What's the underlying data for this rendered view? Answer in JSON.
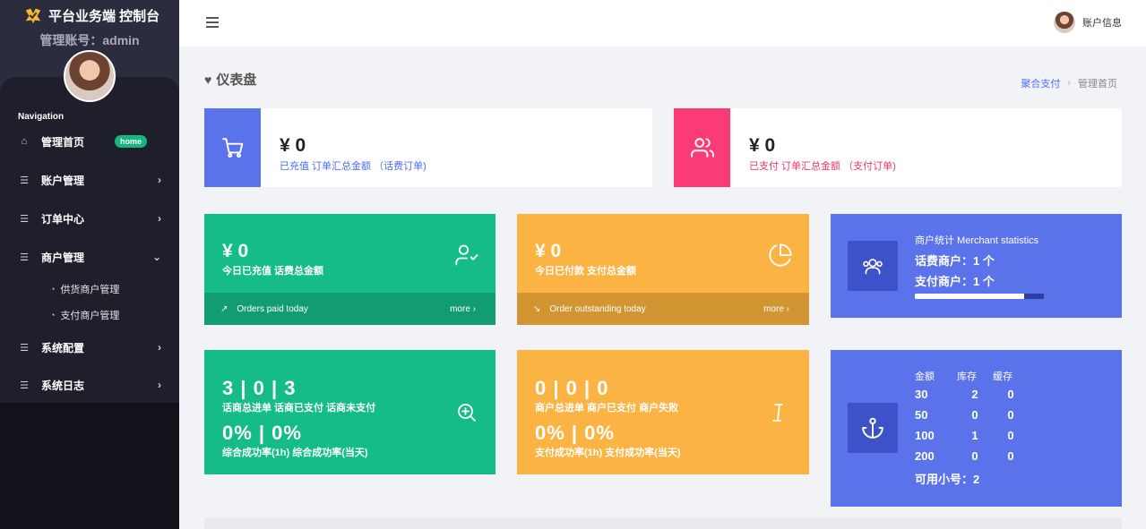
{
  "brand": {
    "title": "平台业务端 控制台",
    "admin_label": "管理账号：admin"
  },
  "nav": {
    "title": "Navigation",
    "items": [
      {
        "label": "管理首页",
        "icon": "home-icon",
        "badge": "home"
      },
      {
        "label": "账户管理",
        "icon": "list-icon"
      },
      {
        "label": "订单中心",
        "icon": "list-icon"
      },
      {
        "label": "商户管理",
        "icon": "list-icon",
        "expanded": true
      },
      {
        "label": "系统配置",
        "icon": "list-icon"
      },
      {
        "label": "系统日志",
        "icon": "list-icon"
      }
    ],
    "sub_items": [
      {
        "label": "供货商户管理"
      },
      {
        "label": "支付商户管理"
      }
    ]
  },
  "header": {
    "account_label": "账户信息"
  },
  "page": {
    "title": "仪表盘",
    "breadcrumb": {
      "root": "聚合支付",
      "current": "管理首页"
    }
  },
  "wide_cards": [
    {
      "amount": "¥ 0",
      "desc": "已充值 订单汇总金额 （话费订单)",
      "color": "#5b73ea",
      "desc_color": "#4c6ef5",
      "icon": "cart-icon"
    },
    {
      "amount": "¥ 0",
      "desc": "已支付 订单汇总金额 （支付订单)",
      "color": "#fb3a78",
      "desc_color": "#f0356d",
      "icon": "users-icon"
    }
  ],
  "today_cards": [
    {
      "amount": "¥ 0",
      "label": "今日已充值 话费总金额",
      "footer": "Orders paid today",
      "more": "more",
      "color": "#16bc88",
      "footer_color": "#129c71",
      "icon": "user-check-icon"
    },
    {
      "amount": "¥ 0",
      "label": "今日已付款 支付总金额",
      "footer": "Order outstanding today",
      "more": "more",
      "color": "#fbb444",
      "footer_color": "#d39532",
      "icon": "pie-chart-icon"
    }
  ],
  "merchant_stats": {
    "title": "商户统计 Merchant statistics",
    "line1": "话费商户：1 个",
    "line2": "支付商户：1 个",
    "progress": 0.85,
    "color": "#5b73ea"
  },
  "order_stats": [
    {
      "counts": "3 | 0 | 3",
      "counts_label": "话商总进单   话商已支付   话商未支付",
      "rates": "0%  |  0%",
      "rates_label": "综合成功率(1h)   综合成功率(当天)",
      "color": "#16bc88",
      "icon": "zoom-in-icon"
    },
    {
      "counts": "0 | 0 | 0",
      "counts_label": "商户总进单   商户已支付   商户失败",
      "rates": "0%  |  0%",
      "rates_label": "支付成功率(1h)   支付成功率(当天)",
      "color": "#fbb444",
      "icon": "text-cursor-icon"
    }
  ],
  "stock": {
    "headers": [
      "金额",
      "库存",
      "缓存"
    ],
    "rows": [
      [
        "30",
        "2",
        "0"
      ],
      [
        "50",
        "0",
        "0"
      ],
      [
        "100",
        "1",
        "0"
      ],
      [
        "200",
        "0",
        "0"
      ]
    ],
    "available": "可用小号：2",
    "color": "#5b73ea",
    "icon": "anchor-icon"
  }
}
